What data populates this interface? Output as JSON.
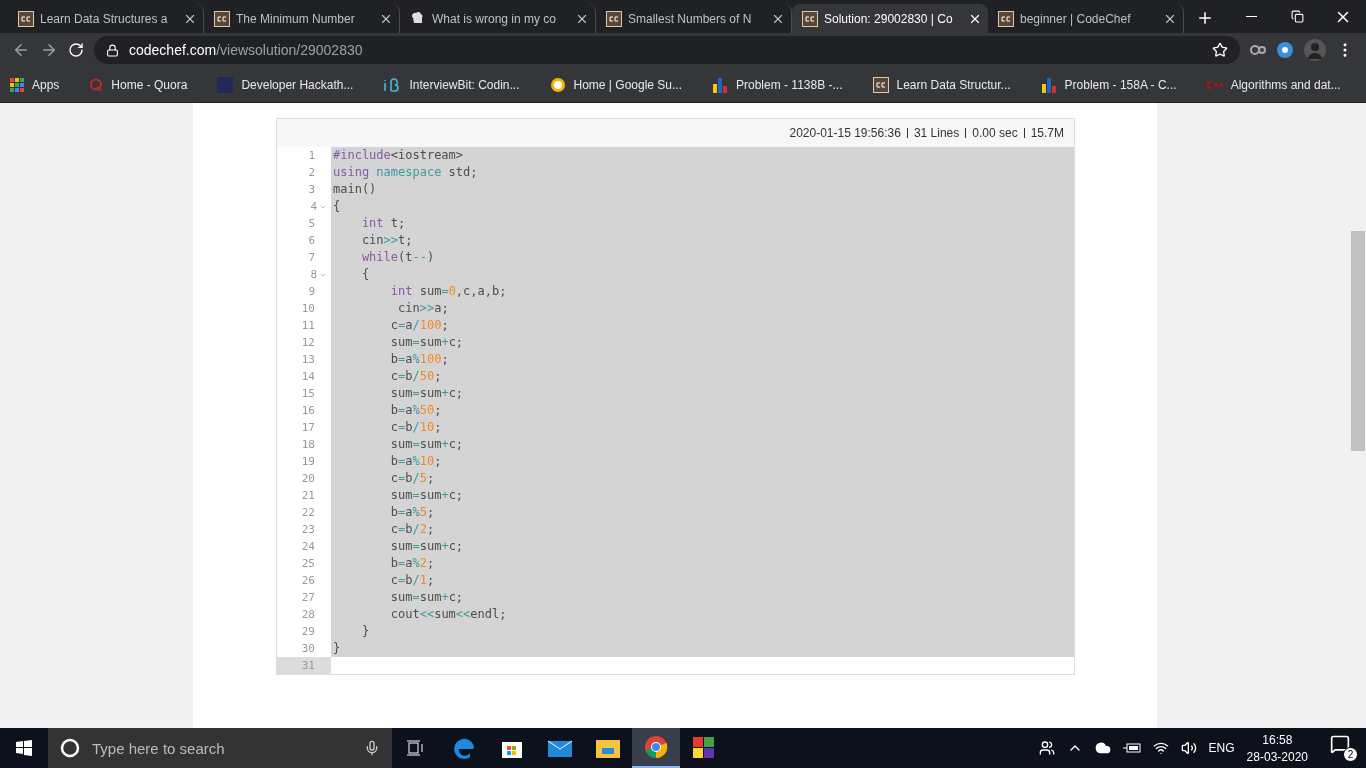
{
  "tabs": [
    {
      "title": "Learn Data Structures a",
      "kind": "cc",
      "selected": false
    },
    {
      "title": "The Minimum Number",
      "kind": "cc",
      "selected": false
    },
    {
      "title": "What is wrong in my co",
      "kind": "hat",
      "selected": false
    },
    {
      "title": "Smallest Numbers of N",
      "kind": "cc",
      "selected": false
    },
    {
      "title": "Solution: 29002830 | Co",
      "kind": "cc",
      "selected": true
    },
    {
      "title": "beginner | CodeChef",
      "kind": "cc",
      "selected": false
    }
  ],
  "address": {
    "host": "codechef.com",
    "path": "/viewsolution/29002830"
  },
  "bookmarks": [
    {
      "label": "Apps",
      "kind": "apps"
    },
    {
      "label": "Home - Quora",
      "kind": "quora"
    },
    {
      "label": "Developer Hackath...",
      "kind": "square"
    },
    {
      "label": "InterviewBit: Codin...",
      "kind": "ib"
    },
    {
      "label": "Home | Google Su...",
      "kind": "sun"
    },
    {
      "label": "Problem - 1138B -...",
      "kind": "bars"
    },
    {
      "label": "Learn Data Structur...",
      "kind": "cc"
    },
    {
      "label": "Problem - 158A - C...",
      "kind": "bars"
    },
    {
      "label": "Algorithms and dat...",
      "kind": "cpp"
    }
  ],
  "code": {
    "meta": [
      "2020-01-15 19:56:36",
      "31 Lines",
      "0.00 sec",
      "15.7M"
    ],
    "lines": [
      {
        "n": "1",
        "fold": false,
        "selected": true,
        "tokens": [
          {
            "text": "#include",
            "kind": "k"
          },
          {
            "text": "<iostream>",
            "kind": "p"
          }
        ]
      },
      {
        "n": "2",
        "fold": false,
        "selected": true,
        "tokens": [
          {
            "text": "using",
            "kind": "k"
          },
          {
            "text": " namespace",
            "kind": "v"
          },
          {
            "text": " std;",
            "kind": "p"
          }
        ]
      },
      {
        "n": "3",
        "fold": false,
        "selected": true,
        "tokens": [
          {
            "text": "main()",
            "kind": "p"
          }
        ]
      },
      {
        "n": "4",
        "fold": true,
        "selected": true,
        "tokens": [
          {
            "text": "{",
            "kind": "p"
          }
        ]
      },
      {
        "n": "5",
        "fold": false,
        "selected": true,
        "tokens": [
          {
            "text": "    int",
            "kind": "k"
          },
          {
            "text": " t;",
            "kind": "p"
          }
        ]
      },
      {
        "n": "6",
        "fold": false,
        "selected": true,
        "tokens": [
          {
            "text": "    cin",
            "kind": "p"
          },
          {
            "text": ">>",
            "kind": "o"
          },
          {
            "text": "t;",
            "kind": "p"
          }
        ]
      },
      {
        "n": "7",
        "fold": false,
        "selected": true,
        "tokens": [
          {
            "text": "    while",
            "kind": "k"
          },
          {
            "text": "(t",
            "kind": "p"
          },
          {
            "text": "--",
            "kind": "o"
          },
          {
            "text": ")",
            "kind": "p"
          }
        ]
      },
      {
        "n": "8",
        "fold": true,
        "selected": true,
        "tokens": [
          {
            "text": "    {",
            "kind": "p"
          }
        ]
      },
      {
        "n": "9",
        "fold": false,
        "selected": true,
        "tokens": [
          {
            "text": "        int",
            "kind": "k"
          },
          {
            "text": " sum",
            "kind": "p"
          },
          {
            "text": "=",
            "kind": "o"
          },
          {
            "text": "0",
            "kind": "n"
          },
          {
            "text": ",c,a,b;",
            "kind": "p"
          }
        ]
      },
      {
        "n": "10",
        "fold": false,
        "selected": true,
        "tokens": [
          {
            "text": "         cin",
            "kind": "p"
          },
          {
            "text": ">>",
            "kind": "o"
          },
          {
            "text": "a;",
            "kind": "p"
          }
        ]
      },
      {
        "n": "11",
        "fold": false,
        "selected": true,
        "tokens": [
          {
            "text": "        c",
            "kind": "p"
          },
          {
            "text": "=",
            "kind": "o"
          },
          {
            "text": "a",
            "kind": "p"
          },
          {
            "text": "/",
            "kind": "o"
          },
          {
            "text": "100",
            "kind": "n"
          },
          {
            "text": ";",
            "kind": "p"
          }
        ]
      },
      {
        "n": "12",
        "fold": false,
        "selected": true,
        "tokens": [
          {
            "text": "        sum",
            "kind": "p"
          },
          {
            "text": "=",
            "kind": "o"
          },
          {
            "text": "sum",
            "kind": "p"
          },
          {
            "text": "+",
            "kind": "o"
          },
          {
            "text": "c;",
            "kind": "p"
          }
        ]
      },
      {
        "n": "13",
        "fold": false,
        "selected": true,
        "tokens": [
          {
            "text": "        b",
            "kind": "p"
          },
          {
            "text": "=",
            "kind": "o"
          },
          {
            "text": "a",
            "kind": "p"
          },
          {
            "text": "%",
            "kind": "o"
          },
          {
            "text": "100",
            "kind": "n"
          },
          {
            "text": ";",
            "kind": "p"
          }
        ]
      },
      {
        "n": "14",
        "fold": false,
        "selected": true,
        "tokens": [
          {
            "text": "        c",
            "kind": "p"
          },
          {
            "text": "=",
            "kind": "o"
          },
          {
            "text": "b",
            "kind": "p"
          },
          {
            "text": "/",
            "kind": "o"
          },
          {
            "text": "50",
            "kind": "n"
          },
          {
            "text": ";",
            "kind": "p"
          }
        ]
      },
      {
        "n": "15",
        "fold": false,
        "selected": true,
        "tokens": [
          {
            "text": "        sum",
            "kind": "p"
          },
          {
            "text": "=",
            "kind": "o"
          },
          {
            "text": "sum",
            "kind": "p"
          },
          {
            "text": "+",
            "kind": "o"
          },
          {
            "text": "c;",
            "kind": "p"
          }
        ]
      },
      {
        "n": "16",
        "fold": false,
        "selected": true,
        "tokens": [
          {
            "text": "        b",
            "kind": "p"
          },
          {
            "text": "=",
            "kind": "o"
          },
          {
            "text": "a",
            "kind": "p"
          },
          {
            "text": "%",
            "kind": "o"
          },
          {
            "text": "50",
            "kind": "n"
          },
          {
            "text": ";",
            "kind": "p"
          }
        ]
      },
      {
        "n": "17",
        "fold": false,
        "selected": true,
        "tokens": [
          {
            "text": "        c",
            "kind": "p"
          },
          {
            "text": "=",
            "kind": "o"
          },
          {
            "text": "b",
            "kind": "p"
          },
          {
            "text": "/",
            "kind": "o"
          },
          {
            "text": "10",
            "kind": "n"
          },
          {
            "text": ";",
            "kind": "p"
          }
        ]
      },
      {
        "n": "18",
        "fold": false,
        "selected": true,
        "tokens": [
          {
            "text": "        sum",
            "kind": "p"
          },
          {
            "text": "=",
            "kind": "o"
          },
          {
            "text": "sum",
            "kind": "p"
          },
          {
            "text": "+",
            "kind": "o"
          },
          {
            "text": "c;",
            "kind": "p"
          }
        ]
      },
      {
        "n": "19",
        "fold": false,
        "selected": true,
        "tokens": [
          {
            "text": "        b",
            "kind": "p"
          },
          {
            "text": "=",
            "kind": "o"
          },
          {
            "text": "a",
            "kind": "p"
          },
          {
            "text": "%",
            "kind": "o"
          },
          {
            "text": "10",
            "kind": "n"
          },
          {
            "text": ";",
            "kind": "p"
          }
        ]
      },
      {
        "n": "20",
        "fold": false,
        "selected": true,
        "tokens": [
          {
            "text": "        c",
            "kind": "p"
          },
          {
            "text": "=",
            "kind": "o"
          },
          {
            "text": "b",
            "kind": "p"
          },
          {
            "text": "/",
            "kind": "o"
          },
          {
            "text": "5",
            "kind": "n"
          },
          {
            "text": ";",
            "kind": "p"
          }
        ]
      },
      {
        "n": "21",
        "fold": false,
        "selected": true,
        "tokens": [
          {
            "text": "        sum",
            "kind": "p"
          },
          {
            "text": "=",
            "kind": "o"
          },
          {
            "text": "sum",
            "kind": "p"
          },
          {
            "text": "+",
            "kind": "o"
          },
          {
            "text": "c;",
            "kind": "p"
          }
        ]
      },
      {
        "n": "22",
        "fold": false,
        "selected": true,
        "tokens": [
          {
            "text": "        b",
            "kind": "p"
          },
          {
            "text": "=",
            "kind": "o"
          },
          {
            "text": "a",
            "kind": "p"
          },
          {
            "text": "%",
            "kind": "o"
          },
          {
            "text": "5",
            "kind": "n"
          },
          {
            "text": ";",
            "kind": "p"
          }
        ]
      },
      {
        "n": "23",
        "fold": false,
        "selected": true,
        "tokens": [
          {
            "text": "        c",
            "kind": "p"
          },
          {
            "text": "=",
            "kind": "o"
          },
          {
            "text": "b",
            "kind": "p"
          },
          {
            "text": "/",
            "kind": "o"
          },
          {
            "text": "2",
            "kind": "n"
          },
          {
            "text": ";",
            "kind": "p"
          }
        ]
      },
      {
        "n": "24",
        "fold": false,
        "selected": true,
        "tokens": [
          {
            "text": "        sum",
            "kind": "p"
          },
          {
            "text": "=",
            "kind": "o"
          },
          {
            "text": "sum",
            "kind": "p"
          },
          {
            "text": "+",
            "kind": "o"
          },
          {
            "text": "c;",
            "kind": "p"
          }
        ]
      },
      {
        "n": "25",
        "fold": false,
        "selected": true,
        "tokens": [
          {
            "text": "        b",
            "kind": "p"
          },
          {
            "text": "=",
            "kind": "o"
          },
          {
            "text": "a",
            "kind": "p"
          },
          {
            "text": "%",
            "kind": "o"
          },
          {
            "text": "2",
            "kind": "n"
          },
          {
            "text": ";",
            "kind": "p"
          }
        ]
      },
      {
        "n": "26",
        "fold": false,
        "selected": true,
        "tokens": [
          {
            "text": "        c",
            "kind": "p"
          },
          {
            "text": "=",
            "kind": "o"
          },
          {
            "text": "b",
            "kind": "p"
          },
          {
            "text": "/",
            "kind": "o"
          },
          {
            "text": "1",
            "kind": "n"
          },
          {
            "text": ";",
            "kind": "p"
          }
        ]
      },
      {
        "n": "27",
        "fold": false,
        "selected": true,
        "tokens": [
          {
            "text": "        sum",
            "kind": "p"
          },
          {
            "text": "=",
            "kind": "o"
          },
          {
            "text": "sum",
            "kind": "p"
          },
          {
            "text": "+",
            "kind": "o"
          },
          {
            "text": "c;",
            "kind": "p"
          }
        ]
      },
      {
        "n": "28",
        "fold": false,
        "selected": true,
        "tokens": [
          {
            "text": "        cout",
            "kind": "p"
          },
          {
            "text": "<<",
            "kind": "o"
          },
          {
            "text": "sum",
            "kind": "p"
          },
          {
            "text": "<<",
            "kind": "o"
          },
          {
            "text": "endl;",
            "kind": "p"
          }
        ]
      },
      {
        "n": "29",
        "fold": false,
        "selected": true,
        "tokens": [
          {
            "text": "    }",
            "kind": "p"
          }
        ]
      },
      {
        "n": "30",
        "fold": false,
        "selected": true,
        "tokens": [
          {
            "text": "}",
            "kind": "p"
          }
        ]
      },
      {
        "n": "31",
        "fold": false,
        "selected": false
      }
    ]
  },
  "taskbar": {
    "search_placeholder": "Type here to search",
    "language": "ENG",
    "time": "16:58",
    "date": "28-03-2020",
    "notifications": "2"
  }
}
